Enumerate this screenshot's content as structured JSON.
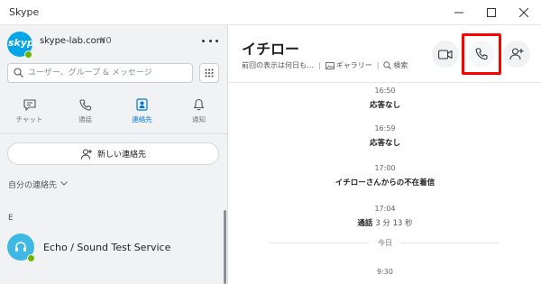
{
  "window": {
    "title": "Skype"
  },
  "profile": {
    "name": "skype-lab.com",
    "credit": "¥0"
  },
  "search": {
    "placeholder": "ユーザー、グループ & メッセージ"
  },
  "nav": [
    {
      "label": "チャット"
    },
    {
      "label": "通話"
    },
    {
      "label": "連絡先"
    },
    {
      "label": "通知"
    }
  ],
  "new_contact": {
    "label": "新しい連絡先"
  },
  "contacts": {
    "filter_label": "自分の連絡先",
    "section_letter": "E",
    "items": [
      {
        "name": "Echo / Sound Test Service"
      }
    ]
  },
  "conversation": {
    "name": "イチロー",
    "subtitle": "前回の表示は何日も…",
    "gallery": "ギャラリー",
    "search": "検索",
    "messages": [
      {
        "time": "16:50",
        "text": "応答なし"
      },
      {
        "time": "16:59",
        "text": "応答なし"
      },
      {
        "time": "17:00",
        "text": "イチローさんからの不在着信"
      },
      {
        "time": "17:04",
        "text": "通話",
        "duration": "3 分 13 秒"
      }
    ],
    "divider": "今日",
    "last_time": "9:30"
  },
  "colors": {
    "accent": "#0078d4",
    "presence": "#6bb700",
    "highlight": "#ff0000"
  }
}
